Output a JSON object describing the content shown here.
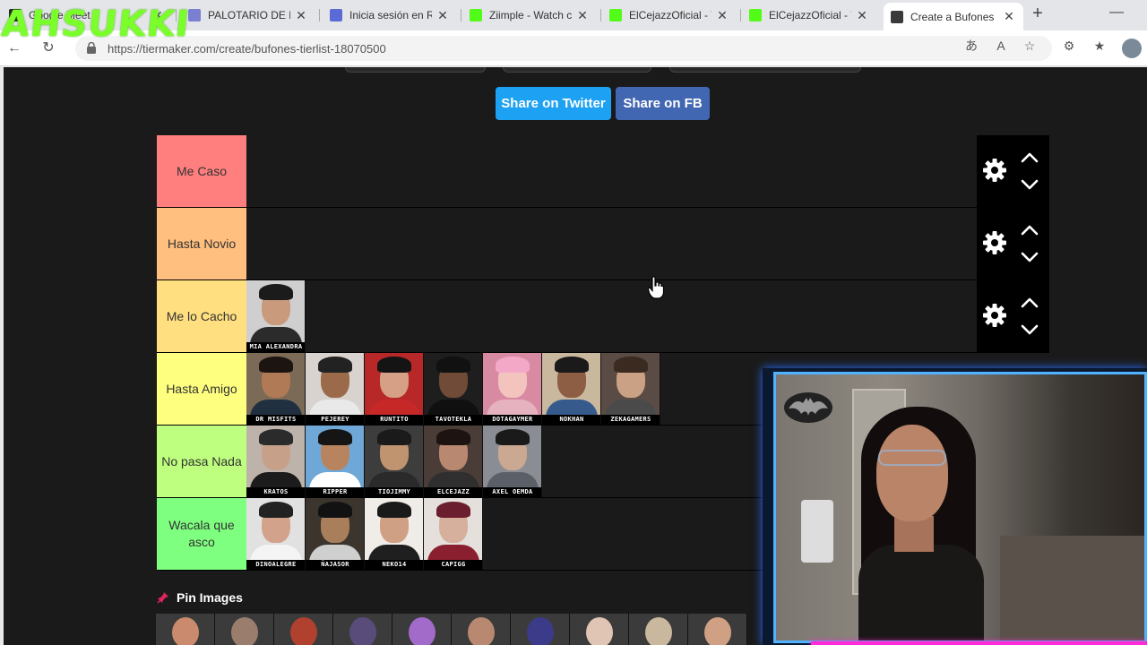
{
  "browser": {
    "tabs": [
      {
        "title": "Google Meet",
        "fav": "#202124"
      },
      {
        "title": "PALOTARIO DE PR",
        "fav": "#7b7fd1"
      },
      {
        "title": "Inicia sesión en Ro",
        "fav": "#5b6bd6"
      },
      {
        "title": "Ziimple - Watch c",
        "fav": "#53fc18"
      },
      {
        "title": "ElCejazzOficial - V",
        "fav": "#53fc18"
      },
      {
        "title": "ElCejazzOficial - V",
        "fav": "#53fc18"
      },
      {
        "title": "Create a Bufones",
        "fav": "#3a3a3a"
      }
    ],
    "url": "https://tiermaker.com/create/bufones-tierlist-18070500"
  },
  "overlay_text": "AHSUKKI",
  "share": {
    "twitter": "Share on Twitter",
    "facebook": "Share on FB"
  },
  "tiers": [
    {
      "label": "Me Caso",
      "color": "#ff7f7f",
      "items": []
    },
    {
      "label": "Hasta Novio",
      "color": "#ffbf7f",
      "items": []
    },
    {
      "label": "Me lo Cacho",
      "color": "#ffdf7f",
      "items": [
        {
          "name": "MIA ALEXANDRA",
          "skin": "#c99a7c",
          "hair": "#1b1b1b",
          "bg": "#cfcfcf",
          "shirt": "#2b2b2b"
        }
      ]
    },
    {
      "label": "Hasta Amigo",
      "color": "#ffff7f",
      "items": [
        {
          "name": "DR MISFITS",
          "skin": "#b07a57",
          "hair": "#1c1410",
          "bg": "#7b6a55",
          "shirt": "#203040"
        },
        {
          "name": "PEJEREY",
          "skin": "#9b6a4a",
          "hair": "#222",
          "bg": "#d8d3cf",
          "shirt": "#e9e9e9"
        },
        {
          "name": "RUNTITO",
          "skin": "#d5a085",
          "hair": "#141414",
          "bg": "#b82828",
          "shirt": "#c62828"
        },
        {
          "name": "TAVOTEKLA",
          "skin": "#6f4b38",
          "hair": "#111",
          "bg": "#1e1e1e",
          "shirt": "#101010"
        },
        {
          "name": "DOTAGAYMER",
          "skin": "#f2c4bd",
          "hair": "#f3a8c8",
          "bg": "#d98aa3",
          "shirt": "#e6b2c0"
        },
        {
          "name": "NOKHAN",
          "skin": "#8d5e43",
          "hair": "#1a1a1a",
          "bg": "#c9b79e",
          "shirt": "#365a8c"
        },
        {
          "name": "ZEKAGAMERS",
          "skin": "#caa185",
          "hair": "#3a2a20",
          "bg": "#5a4c44",
          "shirt": "#4a4a4a"
        }
      ]
    },
    {
      "label": "No pasa Nada",
      "color": "#bfff7f",
      "items": [
        {
          "name": "KRATOS",
          "skin": "#c7a08a",
          "hair": "#2b2b2b",
          "bg": "#bdb3aa",
          "shirt": "#1c1c1c"
        },
        {
          "name": "RIPPER",
          "skin": "#b8845f",
          "hair": "#151515",
          "bg": "#6fa8d6",
          "shirt": "#ffffff"
        },
        {
          "name": "TIOJIMMY",
          "skin": "#c0946e",
          "hair": "#1a1a1a",
          "bg": "#3d3d3d",
          "shirt": "#2a2a2a"
        },
        {
          "name": "ELCEJAZZ",
          "skin": "#b98870",
          "hair": "#1d1411",
          "bg": "#4a3c36",
          "shirt": "#2f2f2f"
        },
        {
          "name": "AXEL OEMDA",
          "skin": "#caa891",
          "hair": "#1a1a1a",
          "bg": "#8a8e94",
          "shirt": "#5b6068"
        }
      ]
    },
    {
      "label": "Wacala que asco",
      "color": "#7fff7f",
      "items": [
        {
          "name": "DINOALEGRE",
          "skin": "#d2a28a",
          "hair": "#222",
          "bg": "#e1e1e1",
          "shirt": "#f4f4f4"
        },
        {
          "name": "ÑAJASOR",
          "skin": "#a97e5a",
          "hair": "#121212",
          "bg": "#3b352e",
          "shirt": "#cfcfcf"
        },
        {
          "name": "NEKO14",
          "skin": "#d0a084",
          "hair": "#1a1a1a",
          "bg": "#f0ece8",
          "shirt": "#1f1f1f"
        },
        {
          "name": "CAPIGG",
          "skin": "#d6b09d",
          "hair": "#6b1e2e",
          "bg": "#e5e0dc",
          "shirt": "#8a1f2f"
        }
      ]
    }
  ],
  "pin": {
    "label": "Pin Images"
  },
  "pool_colors": [
    "#c98a6e",
    "#9a7d6d",
    "#b0412e",
    "#5a4c7a",
    "#a26ac9",
    "#b98870",
    "#3b3b8a",
    "#e0c5b4",
    "#c9b79e",
    "#d0a084"
  ]
}
